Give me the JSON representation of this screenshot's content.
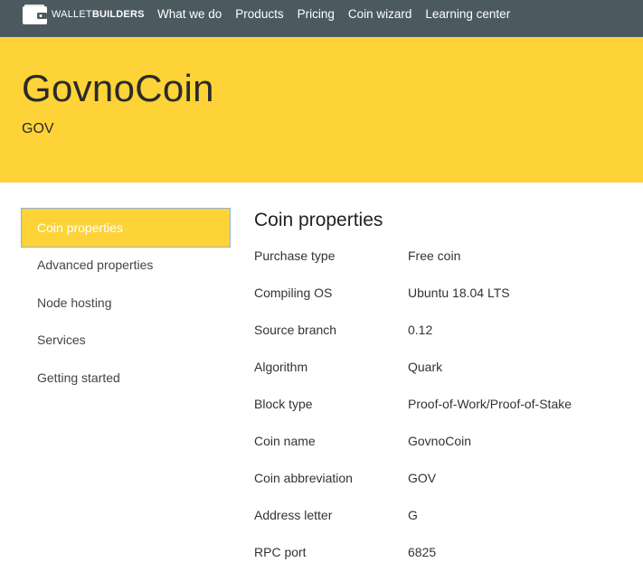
{
  "header": {
    "logo_word_light": "WALLET",
    "logo_word_bold": "BUILDERS",
    "nav": [
      "What we do",
      "Products",
      "Pricing",
      "Coin wizard",
      "Learning center"
    ]
  },
  "hero": {
    "title": "GovnoCoin",
    "subtitle": "GOV"
  },
  "sidebar": {
    "items": [
      {
        "label": "Coin properties",
        "active": true
      },
      {
        "label": "Advanced properties",
        "active": false
      },
      {
        "label": "Node hosting",
        "active": false
      },
      {
        "label": "Services",
        "active": false
      },
      {
        "label": "Getting started",
        "active": false
      }
    ]
  },
  "main": {
    "title": "Coin properties",
    "properties": [
      {
        "key": "Purchase type",
        "value": "Free coin"
      },
      {
        "key": "Compiling OS",
        "value": "Ubuntu 18.04 LTS"
      },
      {
        "key": "Source branch",
        "value": "0.12"
      },
      {
        "key": "Algorithm",
        "value": "Quark"
      },
      {
        "key": "Block type",
        "value": "Proof-of-Work/Proof-of-Stake"
      },
      {
        "key": "Coin name",
        "value": "GovnoCoin"
      },
      {
        "key": "Coin abbreviation",
        "value": "GOV"
      },
      {
        "key": "Address letter",
        "value": "G"
      },
      {
        "key": "RPC port",
        "value": "6825"
      }
    ]
  },
  "colors": {
    "topbar": "#4c5a60",
    "accent_yellow": "#fdd337",
    "active_border": "#8fb0d6"
  }
}
